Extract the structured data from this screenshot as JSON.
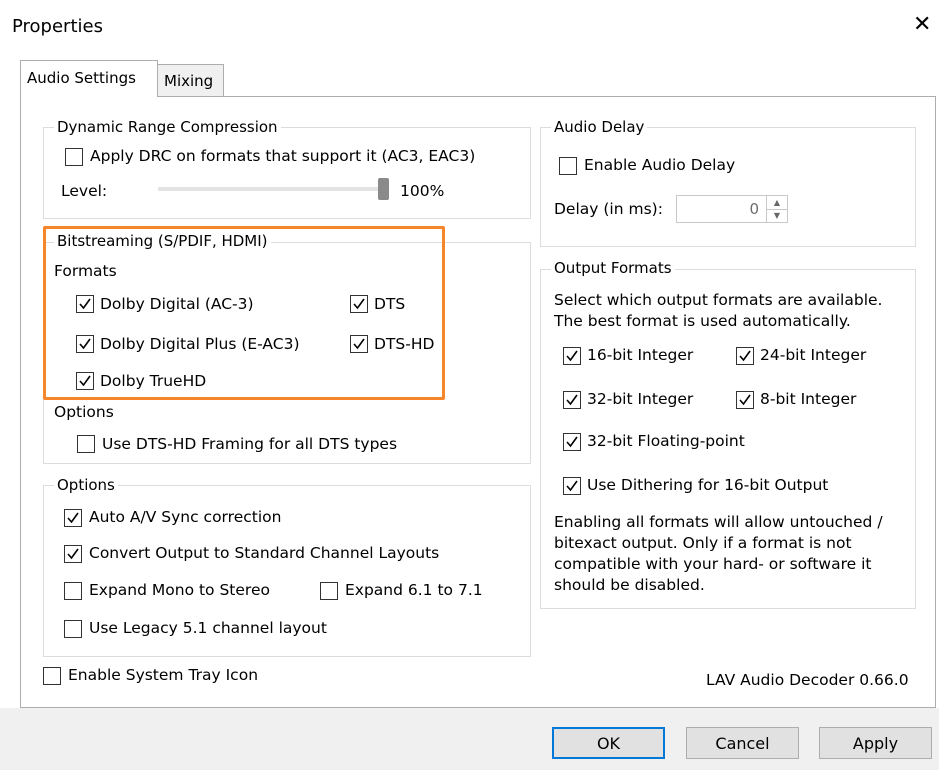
{
  "window": {
    "title": "Properties",
    "close_icon": "close-icon"
  },
  "tabs": [
    {
      "label": "Audio Settings",
      "active": true
    },
    {
      "label": "Mixing",
      "active": false
    }
  ],
  "drc": {
    "group_label": "Dynamic Range Compression",
    "apply_label": "Apply DRC on formats that support it (AC3, EAC3)",
    "apply_checked": false,
    "level_label": "Level:",
    "level_value": "100%",
    "level_fraction": 1.0
  },
  "bitstreaming": {
    "group_label": "Bitstreaming (S/PDIF, HDMI)",
    "formats_label": "Formats",
    "formats": [
      {
        "label": "Dolby Digital (AC-3)",
        "checked": true
      },
      {
        "label": "DTS",
        "checked": true
      },
      {
        "label": "Dolby Digital Plus (E-AC3)",
        "checked": true
      },
      {
        "label": "DTS-HD",
        "checked": true
      },
      {
        "label": "Dolby TrueHD",
        "checked": true
      }
    ],
    "options_label": "Options",
    "dtshd_framing_label": "Use DTS-HD Framing for all DTS types",
    "dtshd_framing_checked": false,
    "highlight_color": "#f7852a"
  },
  "options": {
    "group_label": "Options",
    "items": [
      {
        "label": "Auto A/V Sync correction",
        "checked": true
      },
      {
        "label": "Convert Output to Standard Channel Layouts",
        "checked": true
      },
      {
        "label": "Expand Mono to Stereo",
        "checked": false
      },
      {
        "label": "Expand 6.1 to 7.1",
        "checked": false
      },
      {
        "label": "Use Legacy 5.1 channel layout",
        "checked": false
      }
    ]
  },
  "system_tray": {
    "label": "Enable System Tray Icon",
    "checked": false
  },
  "audio_delay": {
    "group_label": "Audio Delay",
    "enable_label": "Enable Audio Delay",
    "enable_checked": false,
    "delay_label": "Delay (in ms):",
    "delay_value": "0"
  },
  "output_formats": {
    "group_label": "Output Formats",
    "description_line1": "Select which output formats are available.",
    "description_line2": "The best format is used automatically.",
    "formats": [
      {
        "label": "16-bit Integer",
        "checked": true
      },
      {
        "label": "24-bit Integer",
        "checked": true
      },
      {
        "label": "32-bit Integer",
        "checked": true
      },
      {
        "label": "8-bit Integer",
        "checked": true
      },
      {
        "label": "32-bit Floating-point",
        "checked": true
      }
    ],
    "dithering_label": "Use Dithering for 16-bit Output",
    "dithering_checked": true,
    "note_lines": [
      "Enabling all formats will allow untouched /",
      "bitexact output. Only if a format is not",
      "compatible with your hard- or software it",
      "should be disabled."
    ]
  },
  "version_text": "LAV Audio Decoder 0.66.0",
  "buttons": {
    "ok": "OK",
    "cancel": "Cancel",
    "apply": "Apply"
  },
  "colors": {
    "accent": "#0078d7",
    "highlight": "#f7852a"
  }
}
